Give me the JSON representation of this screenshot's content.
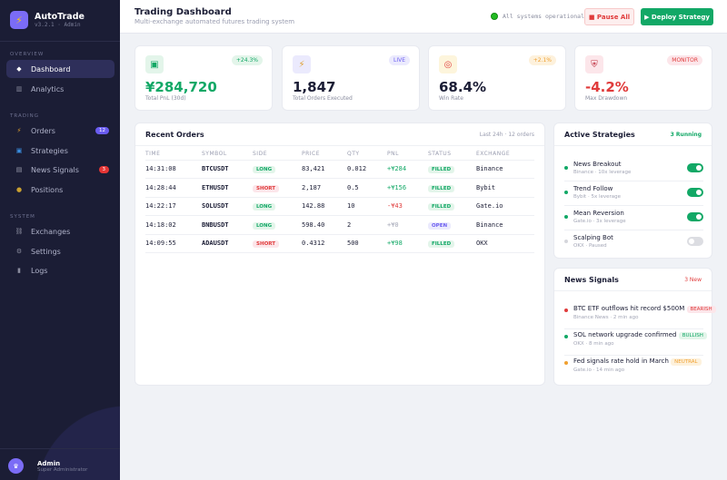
{
  "brand": {
    "name": "AutoTrade",
    "version": "v3.2.1 · Admin",
    "icon": "lightning-icon"
  },
  "sidebar": {
    "sections": [
      "OVERVIEW",
      "TRADING",
      "SYSTEM"
    ],
    "items": [
      {
        "label": "Dashboard",
        "icon": "diamond-icon"
      },
      {
        "label": "Analytics",
        "icon": "bar-chart-icon"
      },
      {
        "label": "Orders",
        "icon": "lightning-icon",
        "badge": "12"
      },
      {
        "label": "Strategies",
        "icon": "gear-box-icon"
      },
      {
        "label": "News Signals",
        "icon": "newspaper-icon",
        "badge": "3"
      },
      {
        "label": "Positions",
        "icon": "money-bag-icon"
      },
      {
        "label": "Exchanges",
        "icon": "link-icon"
      },
      {
        "label": "Settings",
        "icon": "gear-icon"
      },
      {
        "label": "Logs",
        "icon": "clipboard-icon"
      }
    ],
    "user": {
      "name": "Admin",
      "role": "Super Administrator"
    }
  },
  "header": {
    "title": "Trading Dashboard",
    "subtitle": "Multi-exchange automated futures trading system",
    "status": "All systems operational",
    "pause_label": "■ Pause All",
    "deploy_label": "▶ Deploy Strategy"
  },
  "stats": [
    {
      "value": "¥284,720",
      "label": "Total PnL (30d)",
      "pill": "+24.3%",
      "icon": "chart-up-icon"
    },
    {
      "value": "1,847",
      "label": "Total Orders Executed",
      "pill": "LIVE",
      "icon": "lightning-icon"
    },
    {
      "value": "68.4%",
      "label": "Win Rate",
      "pill": "+2.1%",
      "icon": "target-icon"
    },
    {
      "value": "-4.2%",
      "label": "Max Drawdown",
      "pill": "MONITOR",
      "icon": "shield-icon"
    }
  ],
  "orders": {
    "title": "Recent Orders",
    "meta": "Last 24h · 12 orders",
    "columns": [
      "TIME",
      "SYMBOL",
      "SIDE",
      "PRICE",
      "QTY",
      "PNL",
      "STATUS",
      "EXCHANGE"
    ],
    "rows": [
      [
        "14:31:08",
        "BTCUSDT",
        "LONG",
        "83,421",
        "0.012",
        "+¥284",
        "FILLED",
        "Binance"
      ],
      [
        "14:28:44",
        "ETHUSDT",
        "SHORT",
        "2,187",
        "0.5",
        "+¥156",
        "FILLED",
        "Bybit"
      ],
      [
        "14:22:17",
        "SOLUSDT",
        "LONG",
        "142.88",
        "10",
        "-¥43",
        "FILLED",
        "Gate.io"
      ],
      [
        "14:18:02",
        "BNBUSDT",
        "LONG",
        "598.40",
        "2",
        "+¥0",
        "OPEN",
        "Binance"
      ],
      [
        "14:09:55",
        "ADAUSDT",
        "SHORT",
        "0.4312",
        "500",
        "+¥98",
        "FILLED",
        "OKX"
      ]
    ]
  },
  "strategies": {
    "title": "Active Strategies",
    "meta": "3 Running",
    "items": [
      {
        "name": "News Breakout",
        "meta": "Binance · 10x leverage",
        "on": true
      },
      {
        "name": "Trend Follow",
        "meta": "Bybit · 5x leverage",
        "on": true
      },
      {
        "name": "Mean Reversion",
        "meta": "Gate.io · 3x leverage",
        "on": true
      },
      {
        "name": "Scalping Bot",
        "meta": "OKX · Paused",
        "on": false
      }
    ]
  },
  "news": {
    "title": "News Signals",
    "meta": "3 New",
    "items": [
      {
        "title": "BTC ETF outflows hit record $500M",
        "tag": "BEARISH",
        "meta": "Binance News · 2 min ago"
      },
      {
        "title": "SOL network upgrade confirmed",
        "tag": "BULLISH",
        "meta": "OKX · 8 min ago"
      },
      {
        "title": "Fed signals rate hold in March",
        "tag": "NEUTRAL",
        "meta": "Gate.io · 14 min ago"
      }
    ]
  }
}
